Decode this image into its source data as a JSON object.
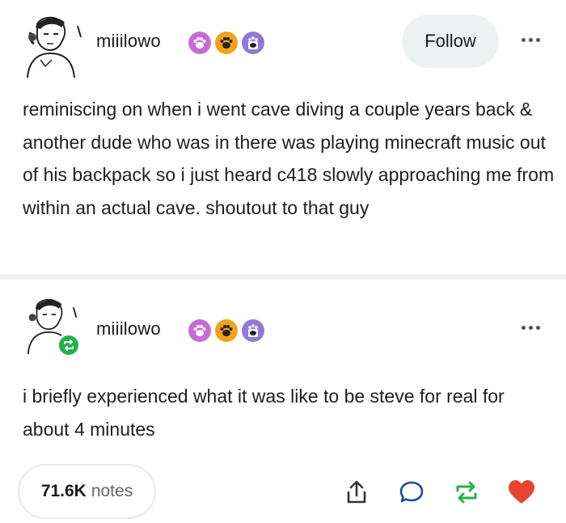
{
  "post": {
    "username": "miiilowo",
    "follow_label": "Follow",
    "text": "reminiscing on when i went cave diving a couple years back & another dude who was in there was playing minecraft music out of his backpack so i just heard c418 slowly approaching me from within an actual cave. shoutout to that guy"
  },
  "reblog": {
    "username": "miiilowo",
    "text": "i briefly experienced what it was like to be steve for real for about 4 minutes"
  },
  "footer": {
    "notes_count": "71.6K",
    "notes_label": "notes"
  },
  "icons": {
    "share": "share-icon",
    "reply": "reply-icon",
    "reblog": "reblog-icon",
    "like": "heart-icon"
  },
  "colors": {
    "reblog_green": "#22b14c",
    "like_red": "#e8452f",
    "badge_pink": "#c86bd6",
    "badge_orange": "#f3a21d",
    "badge_purple": "#8f7ad8"
  }
}
